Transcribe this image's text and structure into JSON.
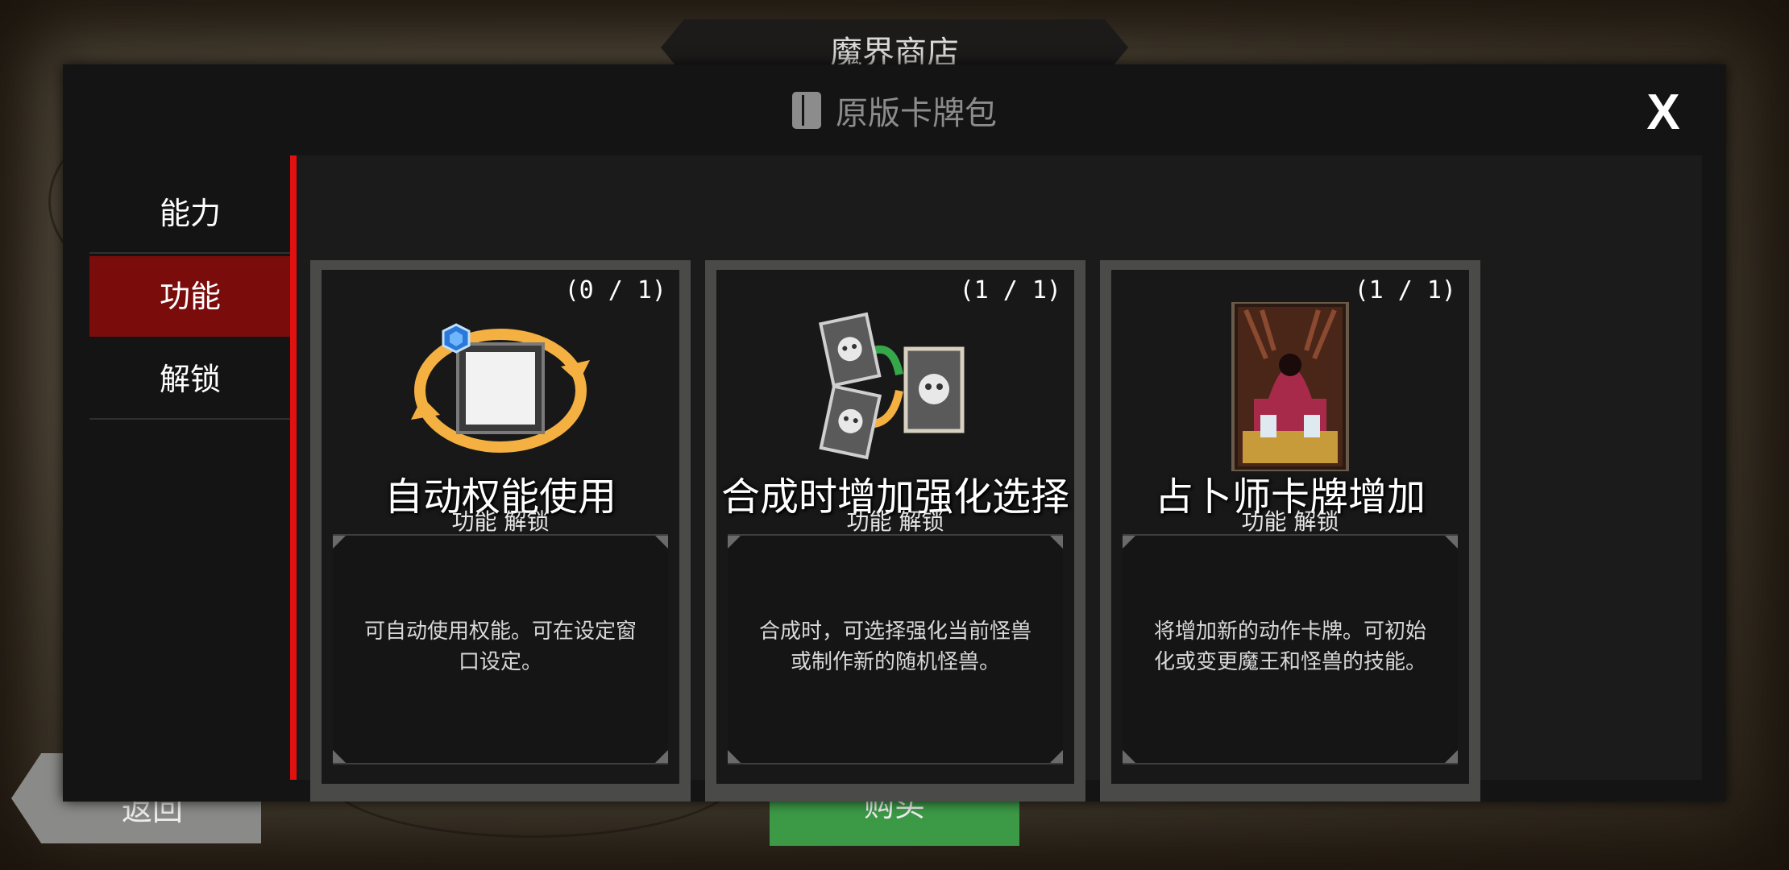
{
  "background": {
    "shop_title": "魔界商店",
    "back_label": "返回",
    "confirm_label": "购买"
  },
  "modal": {
    "title": "原版卡牌包",
    "title_icon": "book-icon",
    "close_label": "X"
  },
  "menu": {
    "items": [
      {
        "label": "能力",
        "active": false
      },
      {
        "label": "功能",
        "active": true
      },
      {
        "label": "解锁",
        "active": false
      }
    ]
  },
  "cards": [
    {
      "count": "(0 / 1)",
      "title": "自动权能使用",
      "tag": "功能  解锁",
      "desc_line1": "可自动使用权能。可在设定窗",
      "desc_line2": "口设定。",
      "icon": "auto-cycle-icon"
    },
    {
      "count": "(1 / 1)",
      "title": "合成时增加强化选择",
      "tag": "功能  解锁",
      "desc_line1": "合成时，可选择强化当前怪兽",
      "desc_line2": "或制作新的随机怪兽。",
      "icon": "merge-cards-icon"
    },
    {
      "count": "(1 / 1)",
      "title": "占卜师卡牌增加",
      "tag": "功能  解锁",
      "desc_line1": "将增加新的动作卡牌。可初始",
      "desc_line2": "化或变更魔王和怪兽的技能。",
      "icon": "fortune-teller-card-icon"
    }
  ],
  "colors": {
    "active_tab": "#7a0c0c",
    "divider": "#e0110f",
    "card_frame": "#4a4a49",
    "ring": "#f4b040"
  }
}
